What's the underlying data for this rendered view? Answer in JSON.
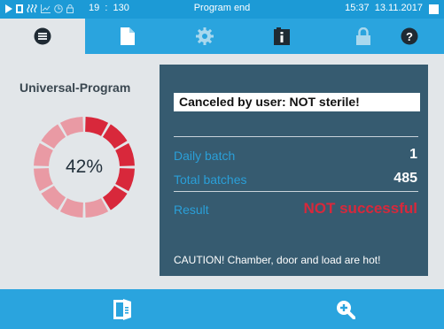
{
  "statusbar": {
    "icons": [
      "play-icon",
      "door-icon",
      "steam-icon",
      "chart-icon",
      "clock-icon",
      "lock-icon"
    ],
    "counter": "19  :  130",
    "status": "Program end",
    "time": "15:37",
    "date": "13.11.2017",
    "background": "#1c9ad6"
  },
  "tabs": [
    {
      "icon": "list-icon",
      "active": true
    },
    {
      "icon": "document-icon",
      "active": false
    },
    {
      "icon": "gear-icon",
      "active": false
    },
    {
      "icon": "info-file-icon",
      "active": false
    },
    {
      "icon": "lock-icon",
      "active": false
    },
    {
      "icon": "help-icon",
      "active": false
    }
  ],
  "program": {
    "title": "Universal-Program",
    "progress_text": "42%",
    "progress_value": 42,
    "segments_total": 12,
    "segments_done": 5,
    "done_color": "#d8283b",
    "remaining_color": "#e99aa4"
  },
  "panel": {
    "message": "Canceled by user: NOT sterile!",
    "rows": [
      {
        "label": "Daily batch",
        "value": "1"
      },
      {
        "label": "Total batches",
        "value": "485"
      }
    ],
    "result_label": "Result",
    "result_value": "NOT successful",
    "caution": "CAUTION! Chamber, door and load are hot!",
    "background": "#365b70"
  },
  "bottombar": {
    "buttons": [
      "door-open-icon",
      "zoom-in-icon"
    ]
  }
}
